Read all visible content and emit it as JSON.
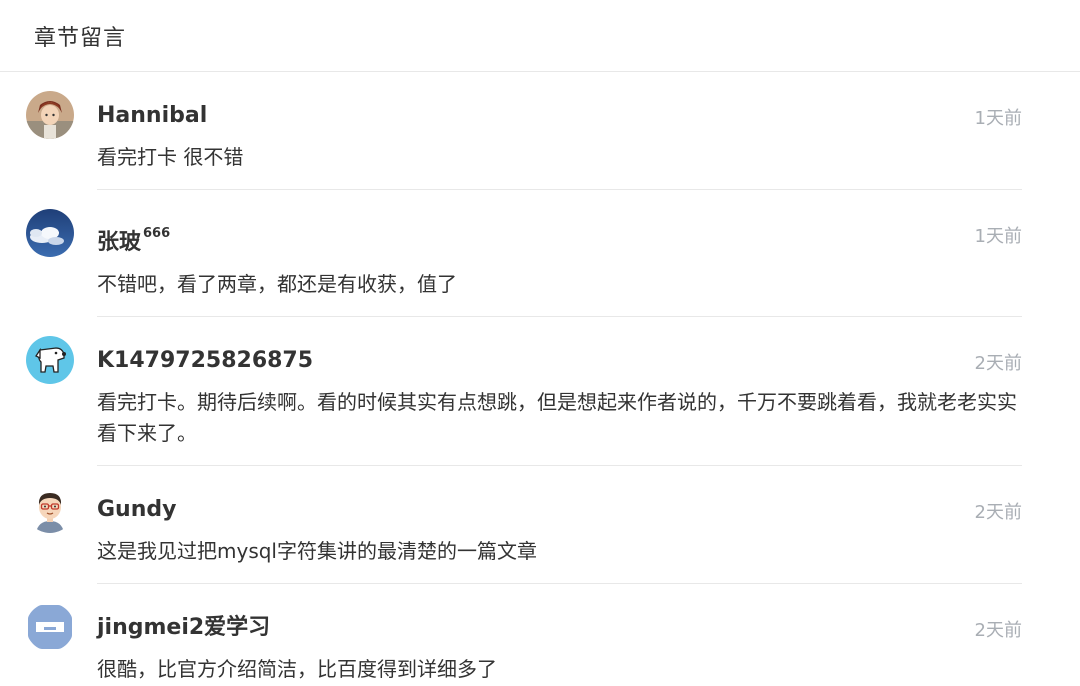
{
  "header": {
    "title": "章节留言"
  },
  "comments": [
    {
      "name": "Hannibal",
      "sup": "",
      "time": "1天前",
      "text": "看完打卡 很不错",
      "avatar": "anime-character-avatar"
    },
    {
      "name": "张玻",
      "sup": "666",
      "time": "1天前",
      "text": "不错吧，看了两章，都还是有收获，值了",
      "avatar": "sky-clouds-avatar"
    },
    {
      "name": "K1479725826875",
      "sup": "",
      "time": "2天前",
      "text": "看完打卡。期待后续啊。看的时候其实有点想跳，但是想起来作者说的，千万不要跳着看，我就老老实实看下来了。",
      "avatar": "cartoon-dog-avatar"
    },
    {
      "name": "Gundy",
      "sup": "",
      "time": "2天前",
      "text": "这是我见过把mysql字符集讲的最清楚的一篇文章",
      "avatar": "cartoon-man-glasses-avatar"
    },
    {
      "name": "jingmei2爱学习",
      "sup": "",
      "time": "2天前",
      "text": "很酷，比官方介绍简洁，比百度得到详细多了",
      "avatar": "default-blue-avatar"
    }
  ],
  "colors": {
    "divider": "#e8e8e8",
    "time": "#a9aeb4",
    "text": "#333333",
    "avatar_blue": "#8aa8d6"
  }
}
